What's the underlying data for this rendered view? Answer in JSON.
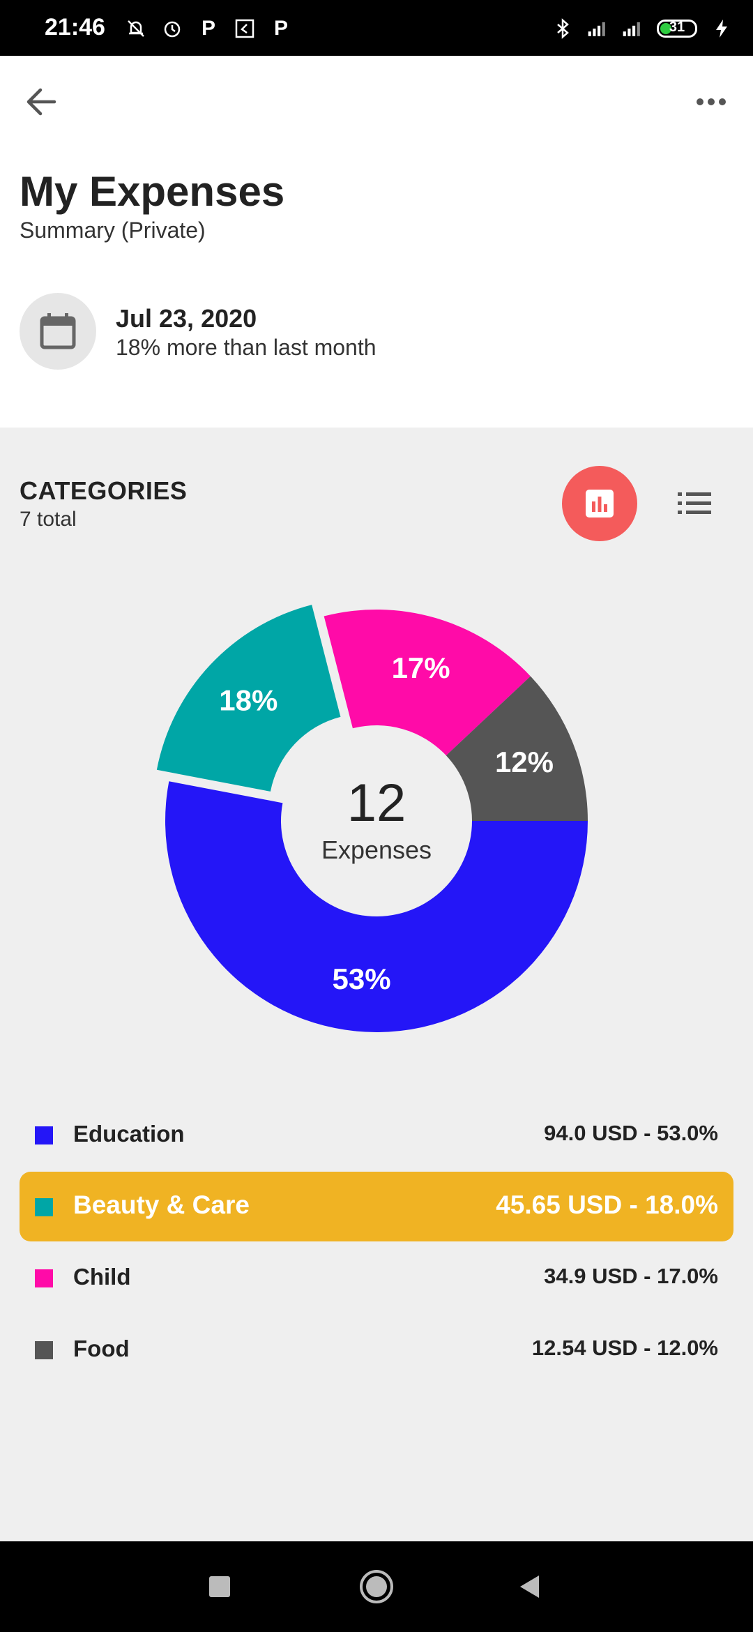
{
  "status_bar": {
    "time": "21:46",
    "battery": "31",
    "icons_left": [
      "mute-bell-icon",
      "alarm-icon",
      "p-icon",
      "app-icon",
      "p-icon"
    ],
    "icons_right": [
      "bluetooth-icon",
      "signal-icon",
      "signal-icon",
      "battery-icon",
      "charging-icon"
    ]
  },
  "header": {
    "title": "My Expenses",
    "subtitle": "Summary (Private)"
  },
  "date_card": {
    "date": "Jul 23, 2020",
    "comparison": "18% more than last month"
  },
  "categories": {
    "title": "CATEGORIES",
    "count": "7 total"
  },
  "donut": {
    "center_number": "12",
    "center_label": "Expenses"
  },
  "chart_data": {
    "type": "pie",
    "subtype": "donut",
    "series": [
      {
        "name": "Education",
        "value": 53,
        "label": "53%",
        "color": "#2416f7"
      },
      {
        "name": "Beauty & Care",
        "value": 18,
        "label": "18%",
        "color": "#00a6a6",
        "exploded": true
      },
      {
        "name": "Child",
        "value": 17,
        "label": "17%",
        "color": "#ff0ba8"
      },
      {
        "name": "Food",
        "value": 12,
        "label": "12%",
        "color": "#555555"
      }
    ]
  },
  "legend": [
    {
      "name": "Education",
      "value": "94.0 USD - 53.0%",
      "color": "#2416f7",
      "selected": false
    },
    {
      "name": "Beauty & Care",
      "value": "45.65 USD - 18.0%",
      "color": "#00a6a6",
      "selected": true
    },
    {
      "name": "Child",
      "value": "34.9 USD - 17.0%",
      "color": "#ff0ba8",
      "selected": false
    },
    {
      "name": "Food",
      "value": "12.54 USD - 12.0%",
      "color": "#555555",
      "selected": false
    }
  ],
  "colors": {
    "accent_red": "#f45b5b",
    "selected_row": "#f0b323"
  }
}
